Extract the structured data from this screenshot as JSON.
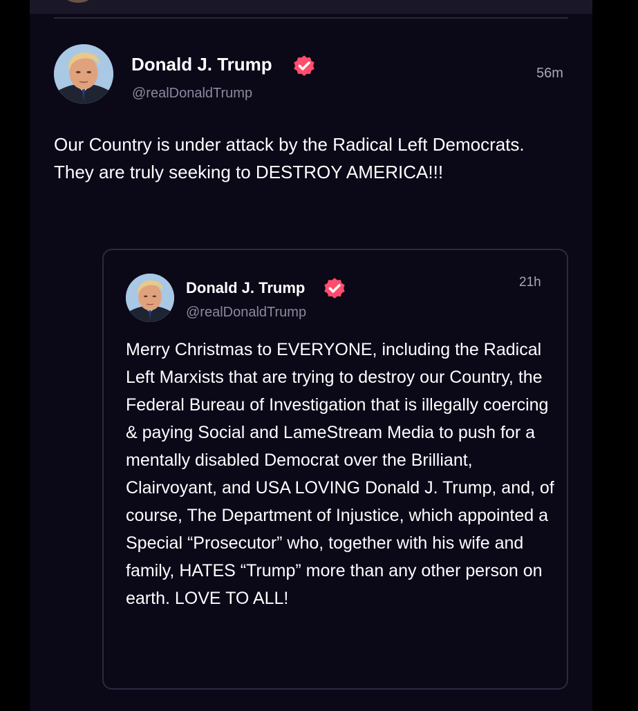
{
  "post": {
    "author_name": "Donald J. Trump",
    "handle": "@realDonaldTrump",
    "time": "56m",
    "text": "Our Country is under attack by the Radical Left Democrats. They are truly seeking to DESTROY AMERICA!!!",
    "verified_icon": "verified-badge-icon"
  },
  "quoted_post": {
    "author_name": "Donald J. Trump",
    "handle": "@realDonaldTrump",
    "time": "21h",
    "text": "Merry Christmas to EVERYONE, including the Radical Left Marxists that are trying to destroy our Country, the Federal Bureau of Investigation that is illegally coercing & paying Social and LameStream Media to push for a mentally disabled Democrat over the Brilliant, Clairvoyant, and USA LOVING Donald J. Trump, and, of course, The Department of Injustice, which appointed a Special “Prosecutor” who, together with his wife and family, HATES “Trump” more than any other person on earth. LOVE TO ALL!",
    "verified_icon": "verified-badge-icon"
  },
  "colors": {
    "background": "#0b0818",
    "text": "#ffffff",
    "handle": "#8a8a9e",
    "verified_badge": "#ff4d6d",
    "card_border": "#2c2a42"
  }
}
